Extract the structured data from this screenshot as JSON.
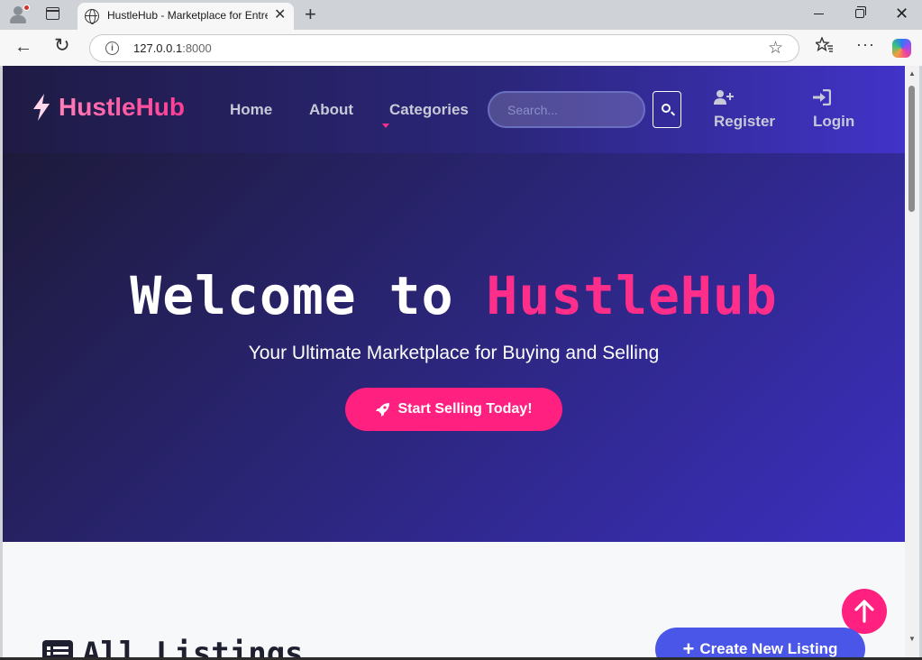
{
  "browser": {
    "tab_title": "HustleHub - Marketplace for Entrepreneurs",
    "url_host": "127.0.0.1",
    "url_port": ":8000",
    "info_glyph": "i",
    "close_glyph": "✕",
    "newtab_glyph": "+",
    "back_glyph": "←",
    "reload_glyph": "↻",
    "star_glyph": "☆",
    "more_glyph": "···",
    "window_close_glyph": "✕"
  },
  "site": {
    "brand": "HustleHub",
    "nav": {
      "home": "Home",
      "about": "About",
      "categories": "Categories",
      "register": "Register",
      "login": "Login"
    },
    "search": {
      "placeholder": "Search..."
    },
    "hero": {
      "title_prefix": "Welcome to ",
      "title_accent": "HustleHub",
      "subtitle": "Your Ultimate Marketplace for Buying and Selling",
      "cta": "Start Selling Today!"
    },
    "listings": {
      "title": "All Listings",
      "create_button": "Create New Listing",
      "create_icon": "+"
    }
  },
  "colors": {
    "accent_pink": "#ff2080",
    "brand_pink": "#ff3c94",
    "nav_dark": "#1f1b45",
    "nav_purple": "#4133c8",
    "create_blue": "#4a56e8"
  },
  "icons": [
    "profile-icon",
    "tab-actions-icon",
    "globe-icon",
    "info-icon",
    "star-icon",
    "favorites-icon",
    "copilot-icon",
    "bolt-icon",
    "search-icon",
    "user-plus-icon",
    "sign-in-icon",
    "rocket-icon",
    "list-icon",
    "arrow-up-icon"
  ]
}
